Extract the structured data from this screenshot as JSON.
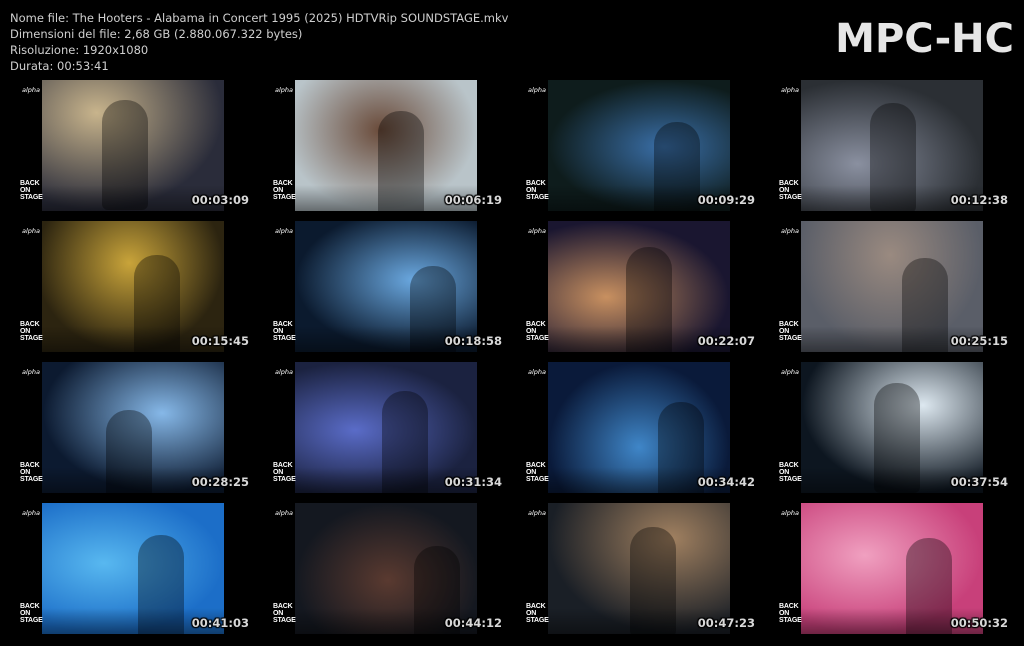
{
  "file_info": {
    "name": "Nome file: The Hooters - Alabama in Concert 1995 (2025) HDTVRip SOUNDSTAGE.mkv",
    "size": "Dimensioni del file: 2,68 GB (2.880.067.322 bytes)",
    "resolution": "Risoluzione: 1920x1080",
    "duration": "Durata: 00:53:41"
  },
  "logo": "MPC-HC",
  "channel_logo": "alpha",
  "show_logo": [
    "BACK",
    "ON",
    "STAGE"
  ],
  "thumbnails": [
    {
      "timestamp": "00:03:09",
      "scene": "guitarist-closeup",
      "colors": [
        "#2a2c3a",
        "#c8b48c"
      ]
    },
    {
      "timestamp": "00:06:19",
      "scene": "singer-microphone",
      "colors": [
        "#b9c4c9",
        "#6a4b3a"
      ]
    },
    {
      "timestamp": "00:09:29",
      "scene": "stage-crowd",
      "colors": [
        "#0e1c1c",
        "#3a6fa8"
      ]
    },
    {
      "timestamp": "00:12:38",
      "scene": "stage-lights-crowd",
      "colors": [
        "#2b2f34",
        "#8a90a0"
      ]
    },
    {
      "timestamp": "00:15:45",
      "scene": "keyboardist-singing",
      "colors": [
        "#2c2410",
        "#c9a43a"
      ]
    },
    {
      "timestamp": "00:18:58",
      "scene": "wide-stage-lights",
      "colors": [
        "#0b1a2e",
        "#6aa8e0"
      ]
    },
    {
      "timestamp": "00:22:07",
      "scene": "acoustic-guitarist",
      "colors": [
        "#1a1630",
        "#c89060"
      ]
    },
    {
      "timestamp": "00:25:15",
      "scene": "singer-closeup",
      "colors": [
        "#5a5e68",
        "#9a8a80"
      ]
    },
    {
      "timestamp": "00:28:25",
      "scene": "crowd-blue-lights",
      "colors": [
        "#0c1a30",
        "#86b8e8"
      ]
    },
    {
      "timestamp": "00:31:34",
      "scene": "band-accordion",
      "colors": [
        "#1b2240",
        "#5a6cc8"
      ]
    },
    {
      "timestamp": "00:34:42",
      "scene": "singer-headset",
      "colors": [
        "#0a1a3a",
        "#3f86c8"
      ]
    },
    {
      "timestamp": "00:37:54",
      "scene": "keyboardist-spotlight",
      "colors": [
        "#0d1620",
        "#dde8f0"
      ]
    },
    {
      "timestamp": "00:41:03",
      "scene": "singer-blue-stage",
      "colors": [
        "#1c6ec8",
        "#58b8f0"
      ]
    },
    {
      "timestamp": "00:44:12",
      "scene": "microphone-closeup",
      "colors": [
        "#141820",
        "#5a3a30"
      ]
    },
    {
      "timestamp": "00:47:23",
      "scene": "bass-guitar",
      "colors": [
        "#1a1f26",
        "#a08060"
      ]
    },
    {
      "timestamp": "00:50:32",
      "scene": "singer-pink-light",
      "colors": [
        "#c8407a",
        "#f0a0c0"
      ]
    }
  ]
}
